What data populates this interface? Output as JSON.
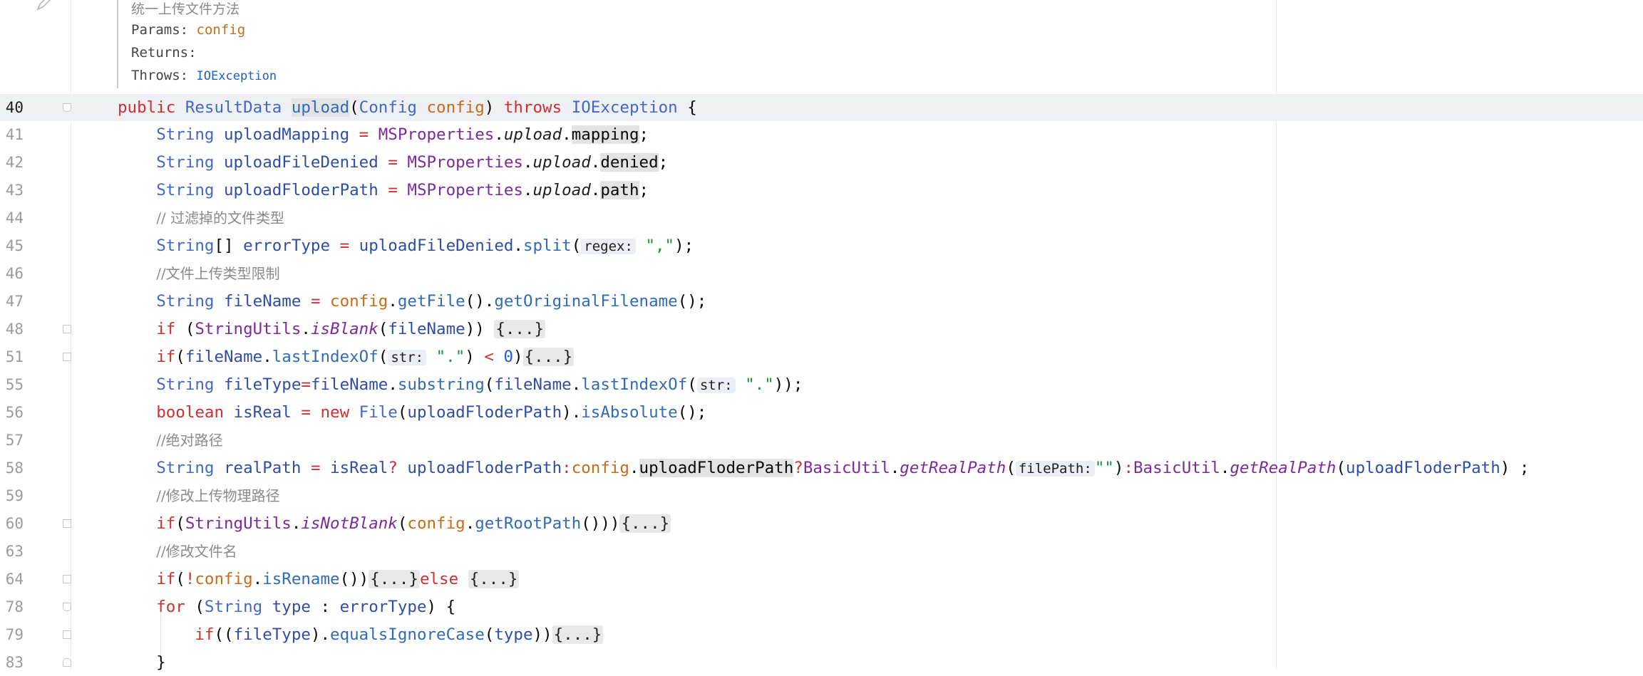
{
  "doc": {
    "summary": "统一上传文件方法",
    "params_label": "Params:",
    "params_value": "config",
    "returns_label": "Returns:",
    "throws_label": "Throws:",
    "throws_value": "IOException"
  },
  "lines": [
    {
      "num": "40"
    },
    {
      "num": "41"
    },
    {
      "num": "42"
    },
    {
      "num": "43"
    },
    {
      "num": "44"
    },
    {
      "num": "45"
    },
    {
      "num": "46"
    },
    {
      "num": "47"
    },
    {
      "num": "48"
    },
    {
      "num": "51"
    },
    {
      "num": "55"
    },
    {
      "num": "56"
    },
    {
      "num": "57"
    },
    {
      "num": "58"
    },
    {
      "num": "59"
    },
    {
      "num": "60"
    },
    {
      "num": "63"
    },
    {
      "num": "64"
    },
    {
      "num": "78"
    },
    {
      "num": "79"
    },
    {
      "num": "83"
    }
  ],
  "hints": {
    "regex": "regex:",
    "str": "str:",
    "filePath": "filePath:"
  },
  "folded_block": "{...}",
  "comments": {
    "l44": "// 过滤掉的文件类型",
    "l46": "//文件上传类型限制",
    "l57": "//绝对路径",
    "l59": "//修改上传物理路径",
    "l63": "//修改文件名"
  },
  "colors": {
    "keyword": "#d02f2f",
    "type": "#4267c7",
    "method": "#2f6bb8",
    "parameter": "#c86b19",
    "string": "#1f8f3a",
    "comment": "#8a8a8a",
    "current_line": "#eef0f4"
  },
  "icons": [
    "edit-pencil-icon",
    "fold-marker-icon"
  ]
}
